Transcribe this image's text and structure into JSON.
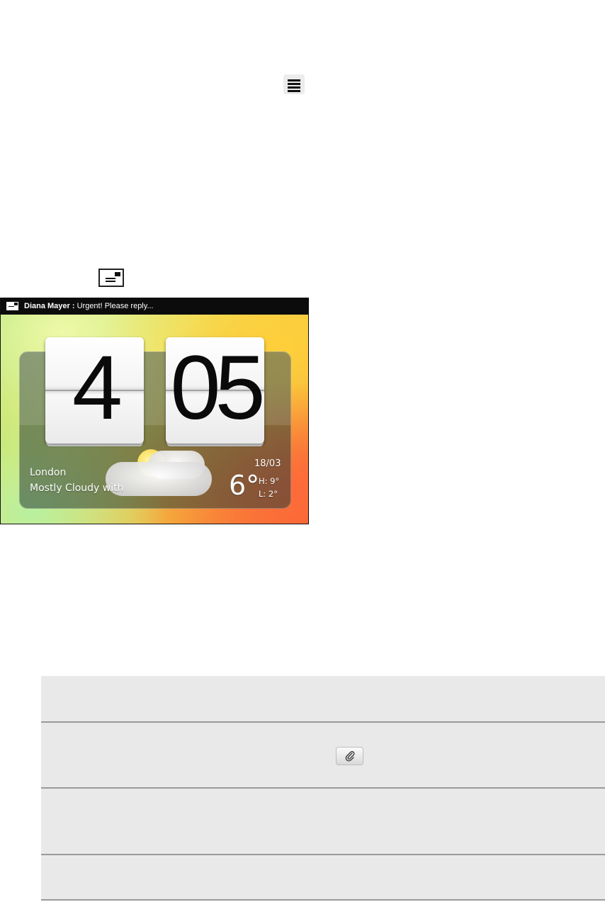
{
  "icons": {
    "menu": "menu-icon",
    "mail_inline": "mail-icon",
    "status_mail": "mail-icon",
    "attachment": "paperclip-icon"
  },
  "phone": {
    "statusbar": {
      "sender": "Diana Mayer :",
      "message": "Urgent! Please reply..."
    },
    "clock": {
      "hour": "4",
      "minute": "05"
    },
    "weather": {
      "city": "London",
      "condition": "Mostly Cloudy with",
      "date": "18/03",
      "temperature": "6°",
      "high": "H:  9°",
      "low": "L:  2°"
    }
  },
  "colors": {
    "table_row_bg": "#e9e9e9",
    "table_border": "#9a9a9a",
    "statusbar_bg": "#0c0c0c"
  }
}
